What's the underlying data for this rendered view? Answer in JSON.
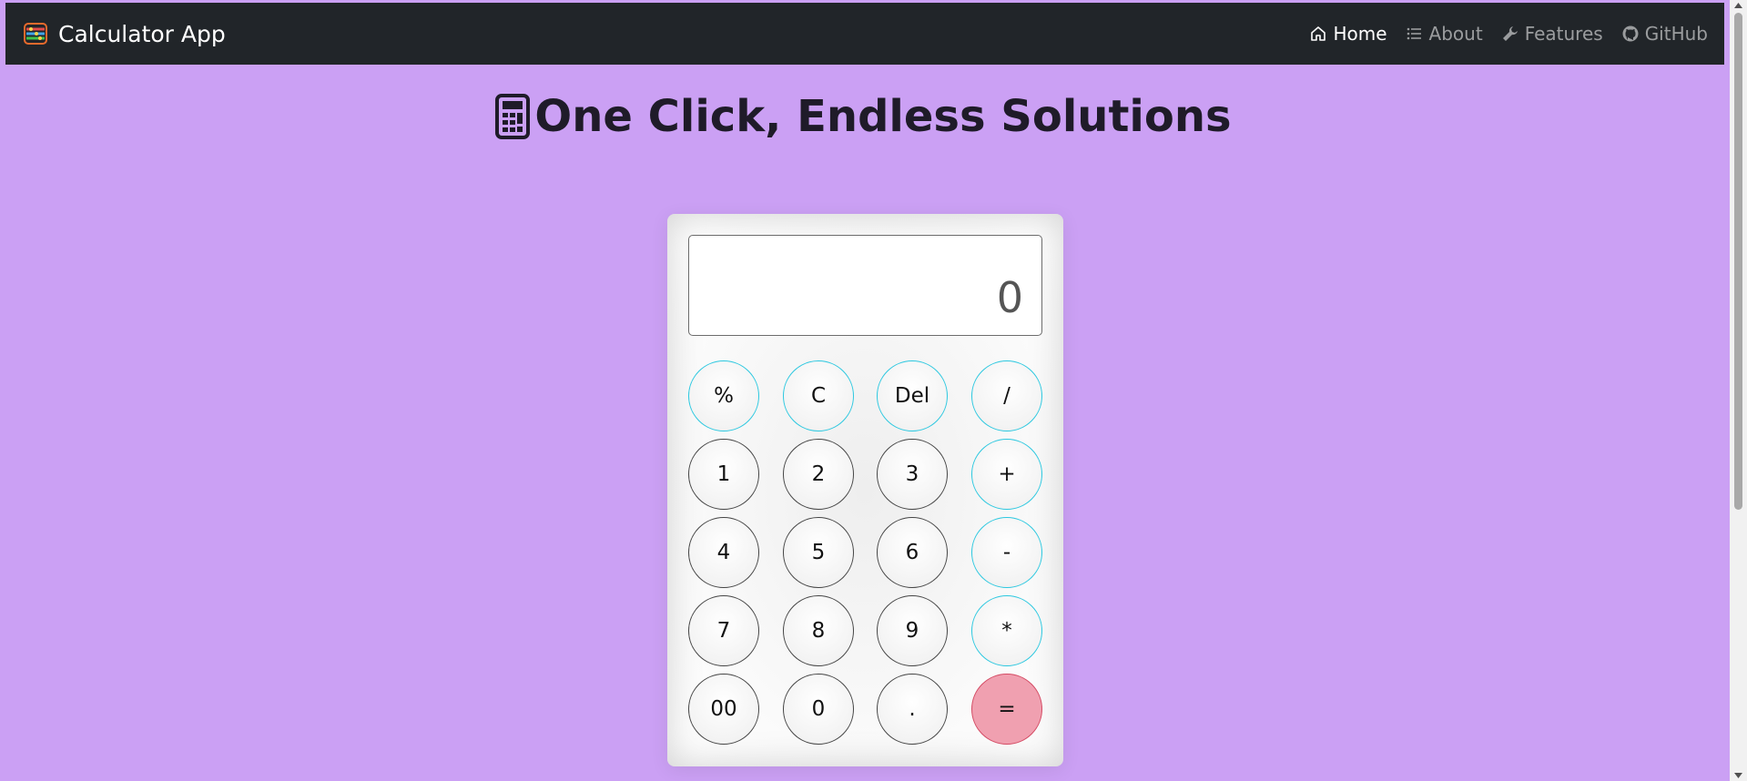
{
  "navbar": {
    "brand": "Calculator App",
    "links": [
      {
        "label": "Home",
        "icon": "home-icon",
        "active": true
      },
      {
        "label": "About",
        "icon": "list-icon",
        "active": false
      },
      {
        "label": "Features",
        "icon": "wrench-icon",
        "active": false
      },
      {
        "label": "GitHub",
        "icon": "github-icon",
        "active": false
      }
    ]
  },
  "headline": "One Click, Endless Solutions",
  "calculator": {
    "display_value": "0",
    "buttons": [
      [
        "%",
        "C",
        "Del",
        "/"
      ],
      [
        "1",
        "2",
        "3",
        "+"
      ],
      [
        "4",
        "5",
        "6",
        "-"
      ],
      [
        "7",
        "8",
        "9",
        "*"
      ],
      [
        "00",
        "0",
        ".",
        "="
      ]
    ]
  },
  "colors": {
    "background": "#cba0f4",
    "navbar": "#212529",
    "operator_border": "#2bc8e0",
    "equals_fill": "#f0a0b0"
  }
}
